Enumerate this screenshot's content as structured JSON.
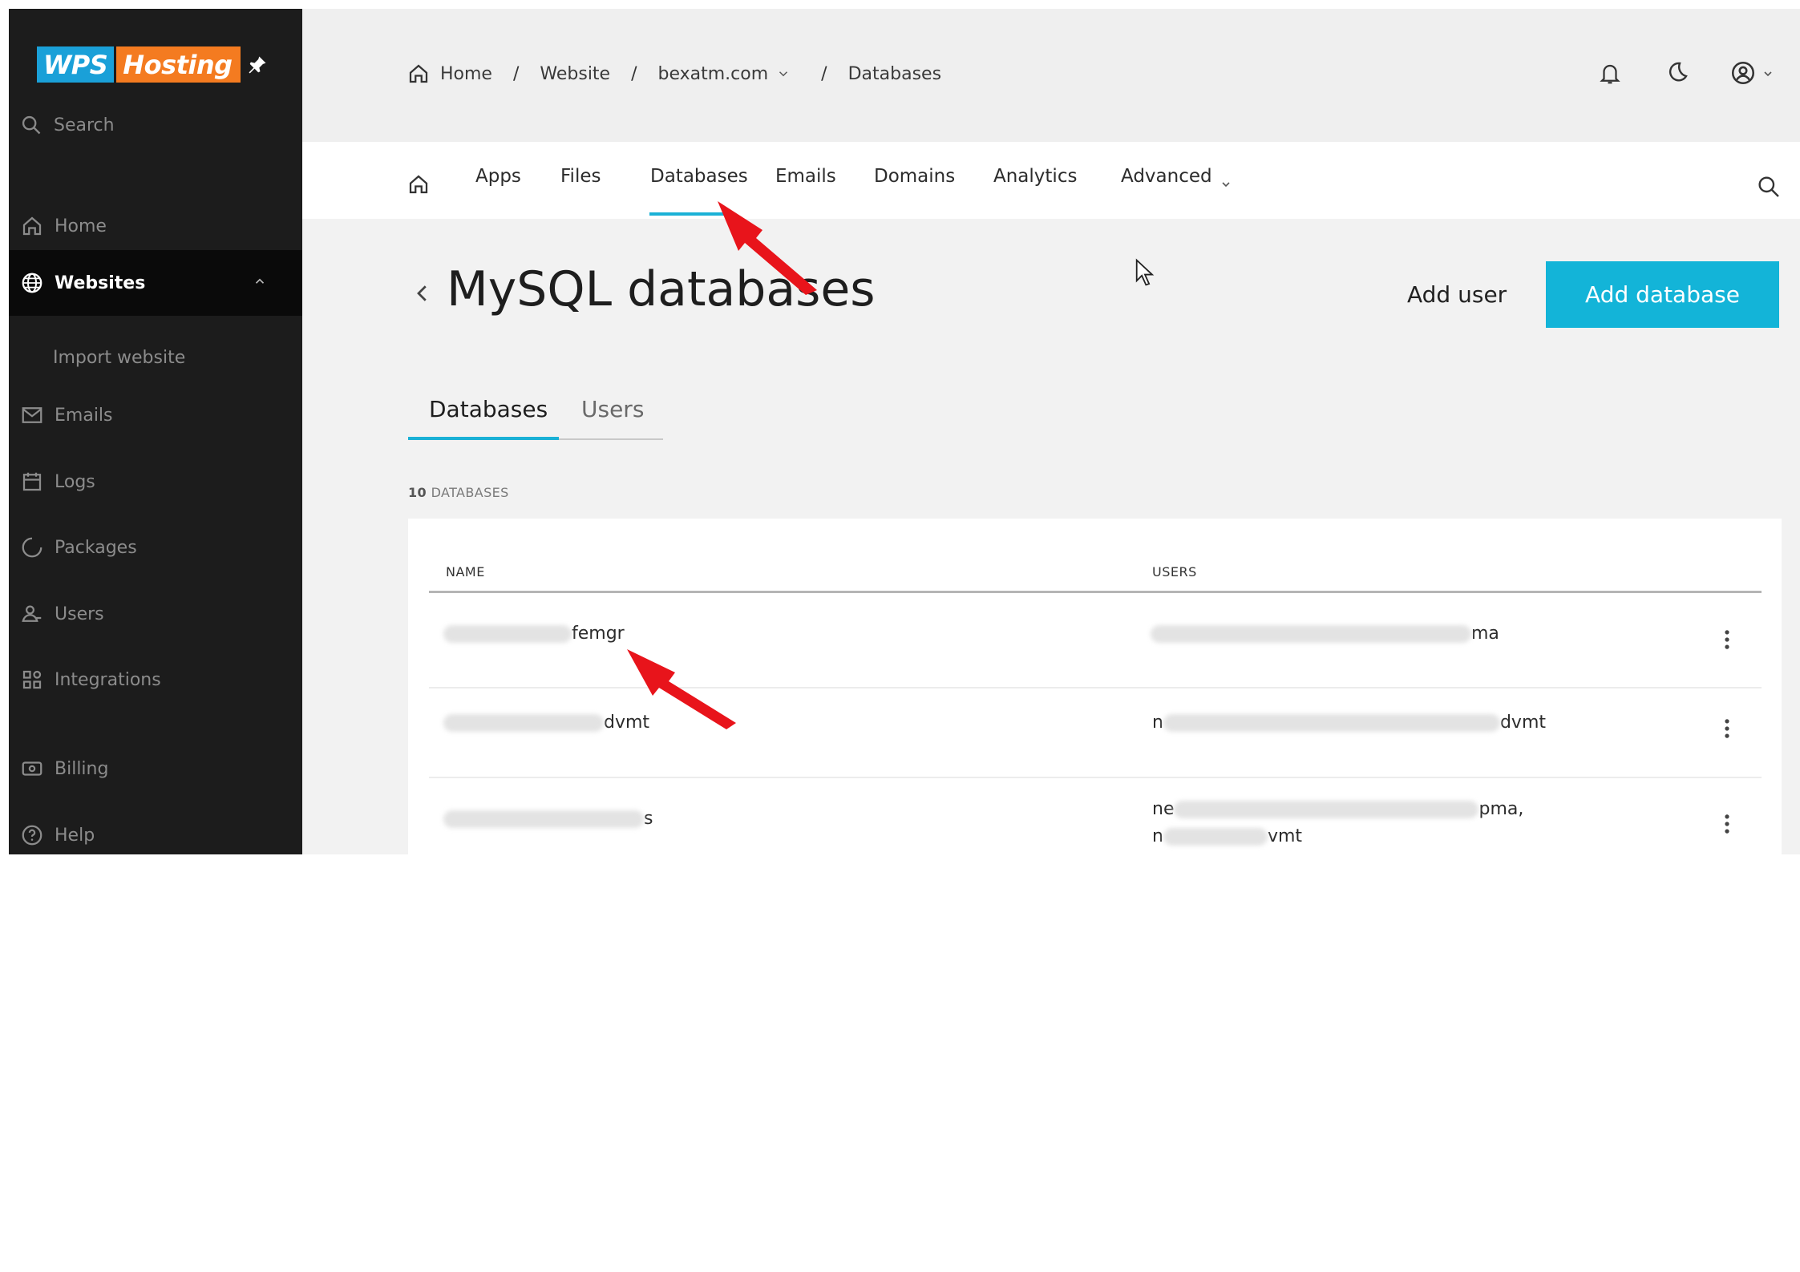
{
  "brand": {
    "wps": "WPS",
    "hosting": "Hosting"
  },
  "sidebar": {
    "search_label": "Search",
    "items": [
      {
        "label": "Home",
        "icon": "home-icon"
      },
      {
        "label": "Websites",
        "icon": "globe-icon",
        "active": true
      },
      {
        "label": "Import website",
        "sub": true
      },
      {
        "label": "Emails",
        "icon": "mail-icon"
      },
      {
        "label": "Logs",
        "icon": "calendar-icon"
      },
      {
        "label": "Packages",
        "icon": "circle-icon"
      },
      {
        "label": "Users",
        "icon": "users-icon"
      },
      {
        "label": "Integrations",
        "icon": "grid-icon"
      },
      {
        "label": "Billing",
        "icon": "billing-icon"
      },
      {
        "label": "Help",
        "icon": "help-icon"
      }
    ]
  },
  "breadcrumb": {
    "home": "Home",
    "website": "Website",
    "domain": "bexatm.com",
    "current": "Databases"
  },
  "nav": {
    "apps": "Apps",
    "files": "Files",
    "databases": "Databases",
    "emails": "Emails",
    "domains": "Domains",
    "analytics": "Analytics",
    "advanced": "Advanced"
  },
  "main": {
    "title": "MySQL databases",
    "add_user": "Add user",
    "add_database": "Add database",
    "tabs": {
      "databases": "Databases",
      "users": "Users"
    },
    "count_number": "10",
    "count_label": "DATABASES"
  },
  "table": {
    "headers": {
      "name": "NAME",
      "users": "USERS"
    },
    "rows": [
      {
        "name_visible": "femgr",
        "users_visible": "ma"
      },
      {
        "name_visible": "dvmt",
        "users_prefix": "n",
        "users_visible": "dvmt"
      },
      {
        "name_visible": "s",
        "users_line1_prefix": "ne",
        "users_line1_visible": "pma,",
        "users_line2_prefix": "n",
        "users_line2_visible": "vmt"
      }
    ]
  },
  "colors": {
    "accent": "#13b4d8",
    "sidebar_bg": "#1c1c1c",
    "annotation_arrow": "#e8141b"
  }
}
